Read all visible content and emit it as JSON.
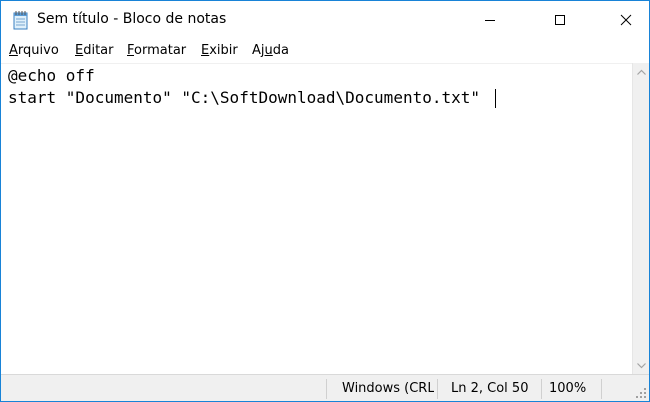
{
  "window": {
    "title": "Sem título - Bloco de notas",
    "accent_color": "#1883d7",
    "icons": {
      "app": "notepad-icon",
      "minimize": "minimize-icon",
      "maximize": "maximize-icon",
      "close": "close-icon"
    }
  },
  "menu": {
    "items": [
      {
        "label_underlined": "A",
        "label_rest": "rquivo"
      },
      {
        "label_underlined": "E",
        "label_rest": "ditar"
      },
      {
        "label_underlined": "F",
        "label_rest": "ormatar"
      },
      {
        "label_underlined": "E",
        "label_rest": "xibir"
      },
      {
        "label_pre": "Aj",
        "label_underlined": "u",
        "label_rest": "da"
      }
    ]
  },
  "editor": {
    "lines": [
      "@echo off",
      "start \"Documento\" \"C:\\SoftDownload\\Documento.txt\""
    ]
  },
  "status": {
    "encoding": "Windows (CRLF)",
    "position": "Ln 2, Col 50",
    "zoom": "100%"
  }
}
